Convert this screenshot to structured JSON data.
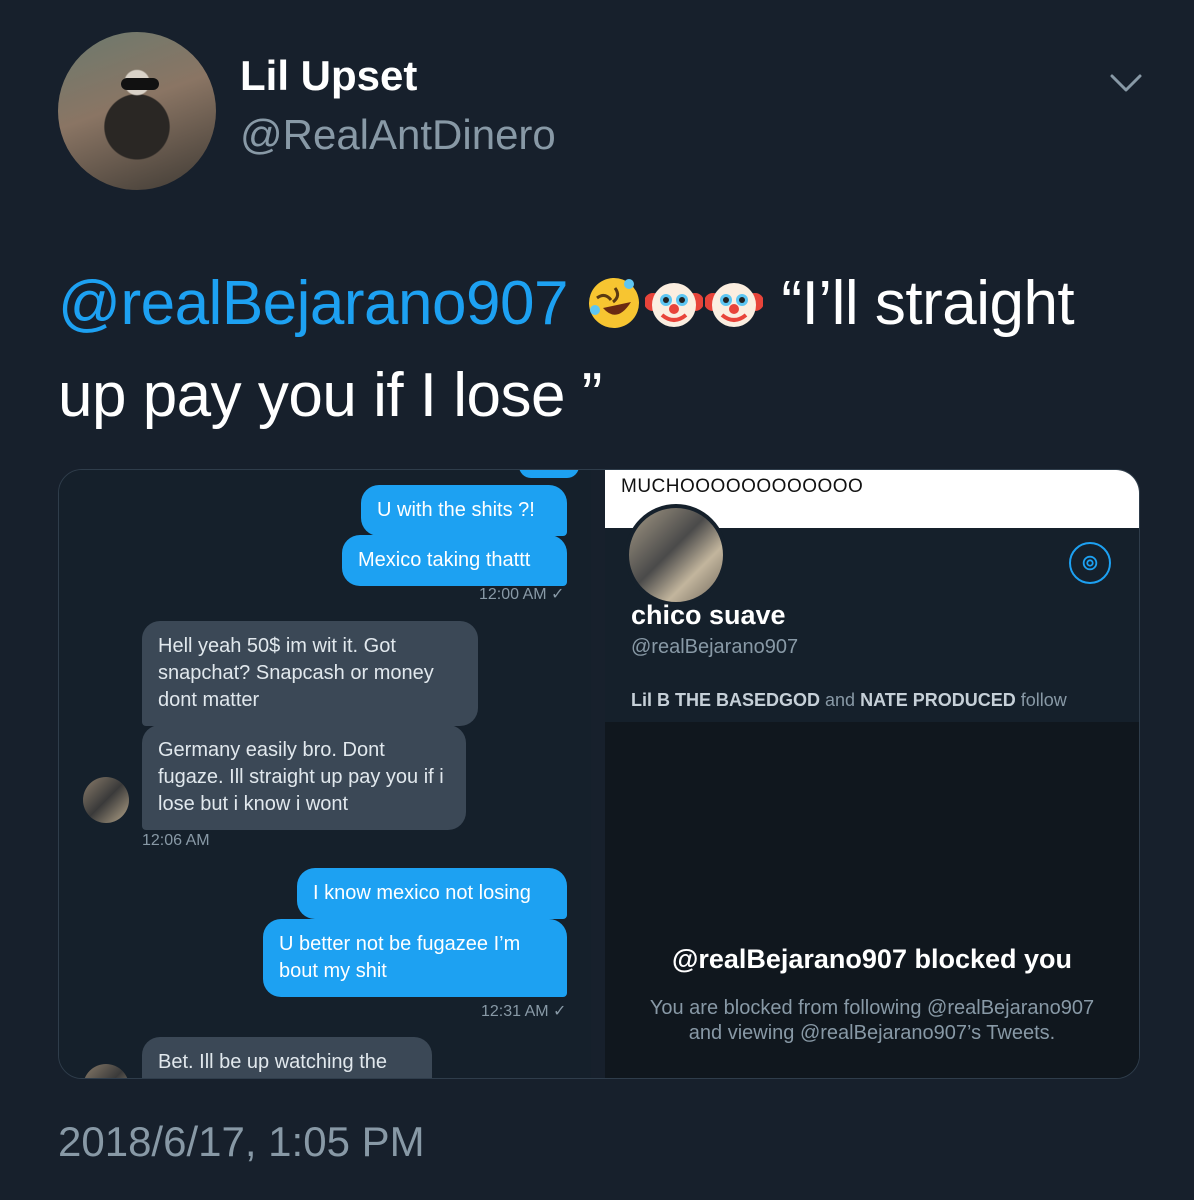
{
  "author": {
    "name": "Lil Upset",
    "handle": "@RealAntDinero"
  },
  "tweet": {
    "mention": "@realBejarano907",
    "emojis": [
      "rolling-on-floor-laughing",
      "clown-face",
      "clown-face"
    ],
    "text": "“I’ll straight up pay you if I lose ”",
    "timestamp": "2018/6/17, 1:05 PM"
  },
  "dm_screenshot": {
    "messages": [
      {
        "dir": "out",
        "text": "U with the shits ?!"
      },
      {
        "dir": "out",
        "text": "Mexico taking thattt"
      },
      {
        "time": "12:00 AM ✓"
      },
      {
        "dir": "in",
        "text": "Hell yeah 50$ im wit it. Got snapchat? Snapcash or money dont matter"
      },
      {
        "dir": "in",
        "text": "Germany easily bro. Dont fugaze. Ill straight up pay you if i lose but i know i wont"
      },
      {
        "time": "12:06 AM"
      },
      {
        "dir": "out",
        "text": "I know mexico not losing"
      },
      {
        "dir": "out",
        "text": "U better not be fugazee I’m bout my shit"
      },
      {
        "time": "12:31 AM ✓"
      },
      {
        "dir": "in",
        "text": "Bet. Ill be up watching the"
      }
    ]
  },
  "profile_screenshot": {
    "top_text": "MUCHOOOOOOOOOOOO",
    "name": "chico suave",
    "handle": "@realBejarano907",
    "followed_by_1": "Lil B THE BASEDGOD",
    "followed_by_and": "and",
    "followed_by_2": "NATE PRODUCED",
    "followed_by_suffix": "follow",
    "blocked_title": "@realBejarano907 blocked you",
    "blocked_body": "You are blocked from following @realBejarano907 and viewing @realBejarano907’s Tweets."
  },
  "colors": {
    "background": "#17202c",
    "accent": "#1da1f2",
    "secondary_text": "#8899a6"
  }
}
